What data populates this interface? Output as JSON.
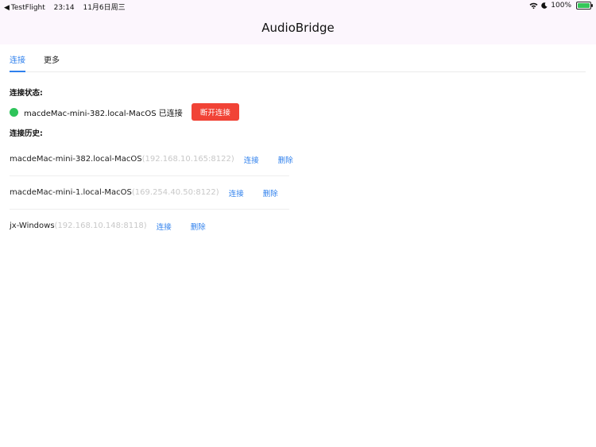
{
  "status_bar": {
    "back_app": "TestFlight",
    "time": "23:14",
    "date": "11月6日周三",
    "battery": "100%",
    "battery_level": 1.0
  },
  "header": {
    "title": "AudioBridge"
  },
  "tabs": [
    {
      "label": "连接",
      "active": true
    },
    {
      "label": "更多",
      "active": false
    }
  ],
  "connection": {
    "status_label": "连接状态:",
    "device": "macdeMac-mini-382.local-MacOS 已连接",
    "disconnect_label": "断开连接"
  },
  "history": {
    "label": "连接历史:",
    "items": [
      {
        "name": "macdeMac-mini-382.local-MacOS",
        "address": "(192.168.10.165:8122)",
        "connect": "连接",
        "delete": "删除"
      },
      {
        "name": "macdeMac-mini-1.local-MacOS",
        "address": "(169.254.40.50:8122)",
        "connect": "连接",
        "delete": "删除"
      },
      {
        "name": "jx-Windows",
        "address": "(192.168.10.148:8118)",
        "connect": "连接",
        "delete": "删除"
      }
    ]
  },
  "colors": {
    "accent": "#2f80ed",
    "danger": "#f14336",
    "connected": "#2ec45a",
    "header_bg": "#fcf6fd"
  }
}
